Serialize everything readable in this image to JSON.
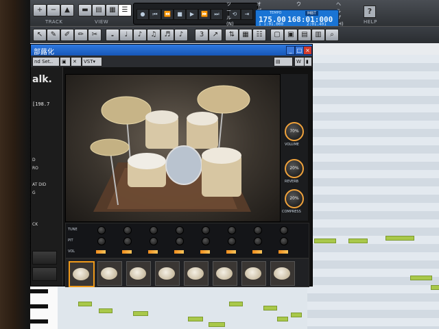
{
  "toolbar": {
    "track_label": "TRACK",
    "view_label": "VIEW",
    "help_label": "HELP",
    "menu_items": [
      "ツール(N)",
      "オプション(O)",
      "ウィンドウ(W)",
      "ヘルプ(H)"
    ]
  },
  "transport_lcd": {
    "tempo_label": "TEMPO",
    "tempo": "175.00",
    "mbt_label": "MBT",
    "position": "168:01:000",
    "sub_left": "1 1:01.000",
    "sub_right": "2:01.401"
  },
  "plugin": {
    "title": "部蕗化",
    "preset_box": "nd Set..",
    "vst_box": "VST▾",
    "brand": "alk.",
    "bpm_display": "[198.7",
    "side_labels": [
      "D",
      "RO",
      "AT DID",
      "G",
      "",
      "CK"
    ],
    "right_knobs": [
      {
        "label": "VOLUME",
        "value": "70%"
      },
      {
        "label": "REVERB",
        "value": "20%"
      },
      {
        "label": "COMPRESS",
        "value": "20%"
      }
    ],
    "mixer_rows": [
      "TUNE",
      "PIT",
      "VOL"
    ],
    "piece_count": 8
  },
  "colors": {
    "accent": "#f09a1a",
    "titlebar": "#1757b8",
    "lcd": "#1a74d4",
    "note_green": "#a9c84a"
  }
}
